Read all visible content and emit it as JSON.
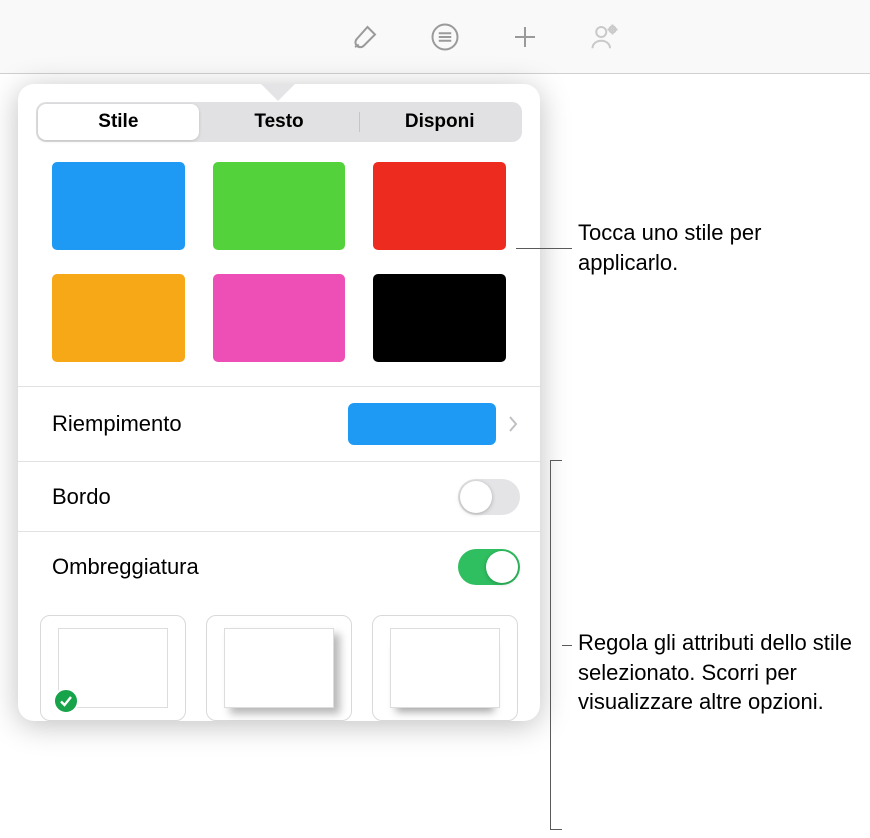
{
  "toolbar": {
    "icons": [
      "brush-icon",
      "list-icon",
      "plus-icon",
      "collaborate-icon"
    ]
  },
  "popover": {
    "tabs": {
      "style": "Stile",
      "text": "Testo",
      "arrange": "Disponi",
      "active": "style"
    },
    "styles": [
      {
        "name": "blue",
        "color": "#1f9af4"
      },
      {
        "name": "green",
        "color": "#53d23b"
      },
      {
        "name": "red",
        "color": "#ed2b1e"
      },
      {
        "name": "orange",
        "color": "#f6a817"
      },
      {
        "name": "pink",
        "color": "#ee4fb6"
      },
      {
        "name": "black",
        "color": "#000000"
      }
    ],
    "fill": {
      "label": "Riempimento",
      "color": "#1f9af4"
    },
    "border": {
      "label": "Bordo",
      "on": false
    },
    "shadow": {
      "label": "Ombreggiatura",
      "on": true,
      "selected": 0
    }
  },
  "callouts": {
    "top": "Tocca uno stile per applicarlo.",
    "bottom": "Regola gli attributi dello stile selezionato. Scorri per visualizzare altre opzioni."
  }
}
